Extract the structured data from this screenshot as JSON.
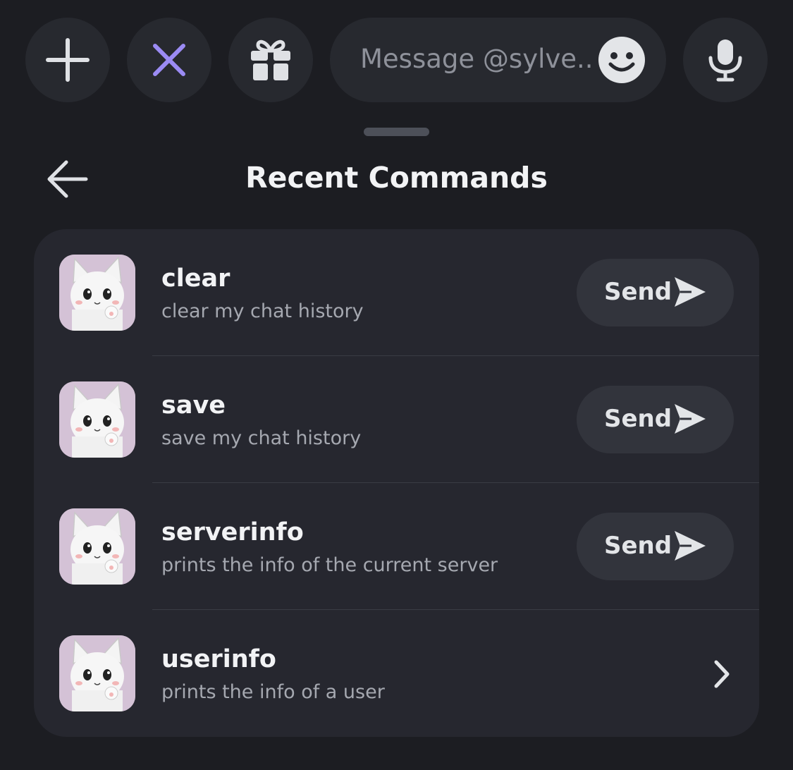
{
  "toolbar": {
    "add_icon": "plus-icon",
    "close_icon": "close-icon",
    "close_color": "#9b8bf4",
    "gift_icon": "gift-icon",
    "message_placeholder": "Message @sylve...",
    "emoji_icon": "emoji-icon",
    "mic_icon": "microphone-icon"
  },
  "header": {
    "back_icon": "arrow-left-icon",
    "title": "Recent Commands"
  },
  "commands": [
    {
      "name": "clear",
      "description": "clear my chat history",
      "action": "Send",
      "action_icon": "send-icon"
    },
    {
      "name": "save",
      "description": "save my chat history",
      "action": "Send",
      "action_icon": "send-icon"
    },
    {
      "name": "serverinfo",
      "description": "prints the info of the current server",
      "action": "Send",
      "action_icon": "send-icon"
    },
    {
      "name": "userinfo",
      "description": "prints the info of a user",
      "action": "",
      "action_icon": "chevron-right-icon"
    }
  ],
  "colors": {
    "background": "#1c1d22",
    "surface": "#26272f",
    "button": "#32343c",
    "avatar_bg": "#d4c2d6"
  }
}
